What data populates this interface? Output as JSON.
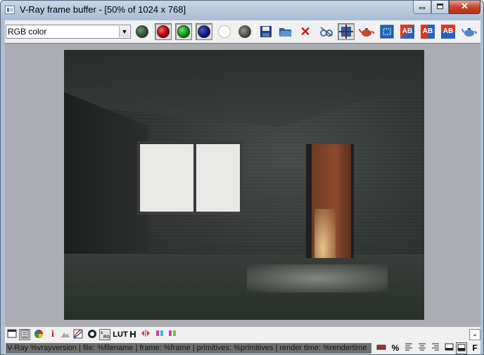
{
  "window": {
    "title": "V-Ray frame buffer - [50% of 1024 x 768]",
    "minimize_icon": "minimize-icon",
    "maximize_icon": "maximize-icon",
    "close_icon": "close-icon",
    "close_glyph": "✕"
  },
  "toolbar": {
    "channel_select": {
      "value": "RGB color",
      "arrow": "▼"
    },
    "buttons": [
      {
        "name": "display-rgb-channels-button",
        "icon": "rgb-channels-icon"
      },
      {
        "name": "red-channel-button",
        "icon": "red-channel-icon",
        "color": "#cc1010"
      },
      {
        "name": "green-channel-button",
        "icon": "green-channel-icon",
        "color": "#10a010"
      },
      {
        "name": "blue-channel-button",
        "icon": "blue-channel-icon",
        "color": "#0d1a7a"
      },
      {
        "name": "alpha-channel-button",
        "icon": "alpha-channel-icon",
        "color": "#ffffff"
      },
      {
        "name": "monochrome-button",
        "icon": "monochrome-icon",
        "color": "#404040"
      },
      {
        "name": "save-image-button",
        "icon": "floppy-disk-icon"
      },
      {
        "name": "load-image-button",
        "icon": "open-folder-icon"
      },
      {
        "name": "clear-image-button",
        "icon": "red-x-icon",
        "glyph": "✕"
      },
      {
        "name": "duplicate-to-max-fb-button",
        "icon": "duplicate-icon"
      },
      {
        "name": "track-mouse-button",
        "icon": "crosshair-icon"
      },
      {
        "name": "render-last-button",
        "icon": "teapot-icon"
      },
      {
        "name": "region-render-button",
        "icon": "region-icon"
      },
      {
        "name": "compare-ab-horizontal-button",
        "icon": "ab-horizontal-icon",
        "glyph": "AB"
      },
      {
        "name": "compare-ab-button",
        "icon": "ab-icon",
        "glyph": "AB"
      },
      {
        "name": "compare-ab-vertical-button",
        "icon": "ab-vertical-icon",
        "glyph": "AB"
      },
      {
        "name": "render-button",
        "icon": "render-teapot-icon"
      }
    ],
    "colors": {
      "accent_blue": "#1f5fb5",
      "accent_red": "#c22a1a"
    }
  },
  "bottombar": {
    "buttons": [
      {
        "name": "show-corrections-button",
        "icon": "window-icon"
      },
      {
        "name": "levels-button",
        "icon": "levels-icon"
      },
      {
        "name": "color-correction-button",
        "icon": "color-palette-icon"
      },
      {
        "name": "pixel-info-button",
        "icon": "info-icon",
        "glyph": "i"
      },
      {
        "name": "lens-effects-button",
        "icon": "landscape-icon"
      },
      {
        "name": "curve-button",
        "icon": "curve-icon"
      },
      {
        "name": "exposure-button",
        "icon": "exposure-icon"
      },
      {
        "name": "srgb-button",
        "icon": "srgb-icon"
      },
      {
        "name": "lut-button",
        "icon": "lut-icon",
        "glyph": "LUT"
      },
      {
        "name": "histogram-button",
        "icon": "histogram-icon",
        "glyph": "H"
      },
      {
        "name": "flip-horizontal-button",
        "icon": "flip-icon"
      },
      {
        "name": "stereo-red-cyan-button",
        "icon": "stereo-icon"
      },
      {
        "name": "stereo-green-magenta-button",
        "icon": "stereo-green-icon"
      }
    ],
    "expand_glyph": "⌄"
  },
  "statusrow": {
    "stamp_text": "V-Ray %vrayversion | file: %filename | frame: %frame | primitives: %primitives | render time: %rendertime",
    "percent_label": "%",
    "bold_label": "F"
  }
}
